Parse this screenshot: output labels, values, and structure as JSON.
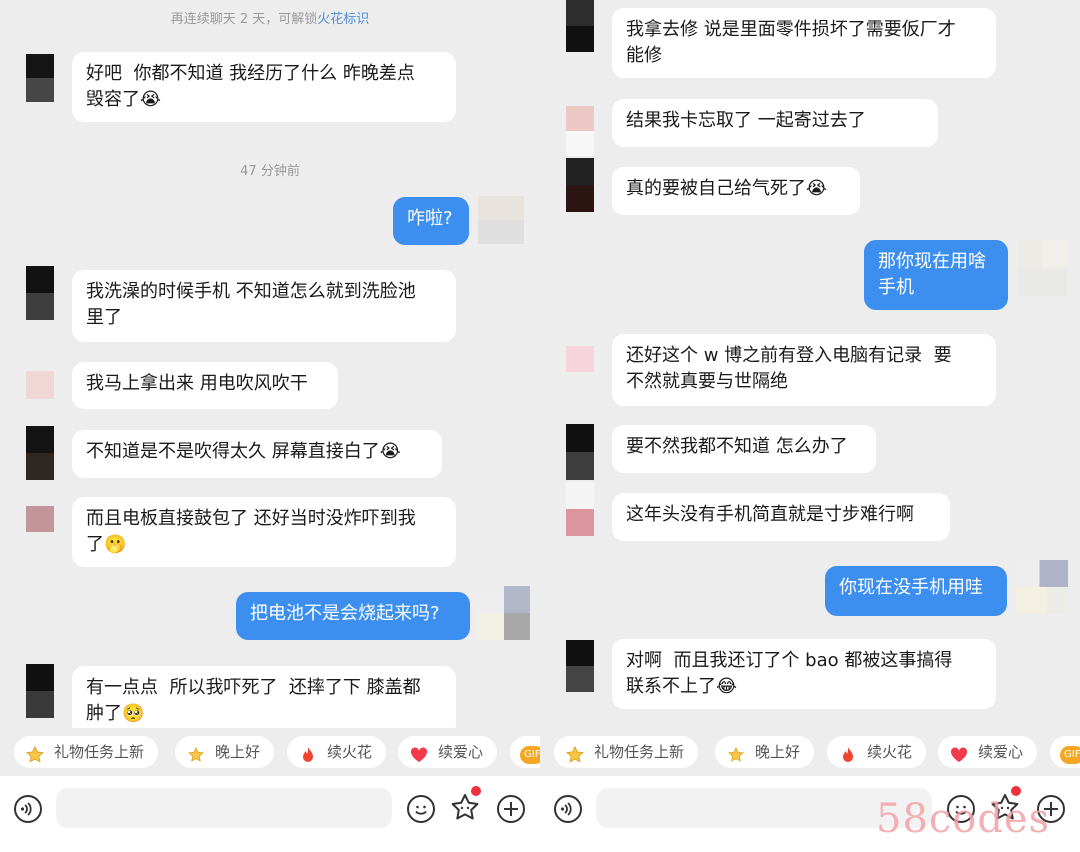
{
  "colors": {
    "sent_bubble": "#3d8fef",
    "received_bubble": "#ffffff",
    "background": "#ededed",
    "notification_dot": "#f0303c"
  },
  "left": {
    "hint": {
      "prefix": "再连续聊天 2 天，可解锁",
      "accent": "火花标识"
    },
    "time": "47 分钟前",
    "messages": [
      {
        "text": "好吧  你都不知道 我经历了什么 昨晚差点\n毁容了😭"
      },
      {
        "text": "咋啦?"
      },
      {
        "text": "我洗澡的时候手机 不知道怎么就到洗脸池\n里了"
      },
      {
        "text": "我马上拿出来 用电吹风吹干"
      },
      {
        "text": "不知道是不是吹得太久 屏幕直接白了😭"
      },
      {
        "text": "而且电板直接鼓包了 还好当时没炸吓到我\n了🫢"
      },
      {
        "text": "把电池不是会烧起来吗?"
      },
      {
        "text": "有一点点  所以我吓死了  还摔了下 膝盖都\n肿了🥺"
      }
    ]
  },
  "right": {
    "messages": [
      {
        "text": "我拿去修 说是里面零件损坏了需要仮厂才\n能修"
      },
      {
        "text": "结果我卡忘取了 一起寄过去了"
      },
      {
        "text": "真的要被自己给气死了😭"
      },
      {
        "text": "那你现在用啥\n手机"
      },
      {
        "text": "还好这个 w 博之前有登入电脑有记录  要\n不然就真要与世隔绝"
      },
      {
        "text": "要不然我都不知道 怎么办了"
      },
      {
        "text": "这年头没有手机简直就是寸步难行啊"
      },
      {
        "text": "你现在没手机用哇"
      },
      {
        "text": "对啊  而且我还订了个 bao 都被这事搞得\n联系不上了😂"
      }
    ]
  },
  "quick_replies": [
    {
      "label": "礼物任务上新",
      "icon": "gift-star-icon"
    },
    {
      "label": "晚上好",
      "icon": "moon-star-icon"
    },
    {
      "label": "续火花",
      "icon": "fire-icon"
    },
    {
      "label": "续爱心",
      "icon": "heart-icon"
    },
    {
      "label": "GIF",
      "icon": "gif-icon"
    }
  ],
  "watermark": "58codes"
}
